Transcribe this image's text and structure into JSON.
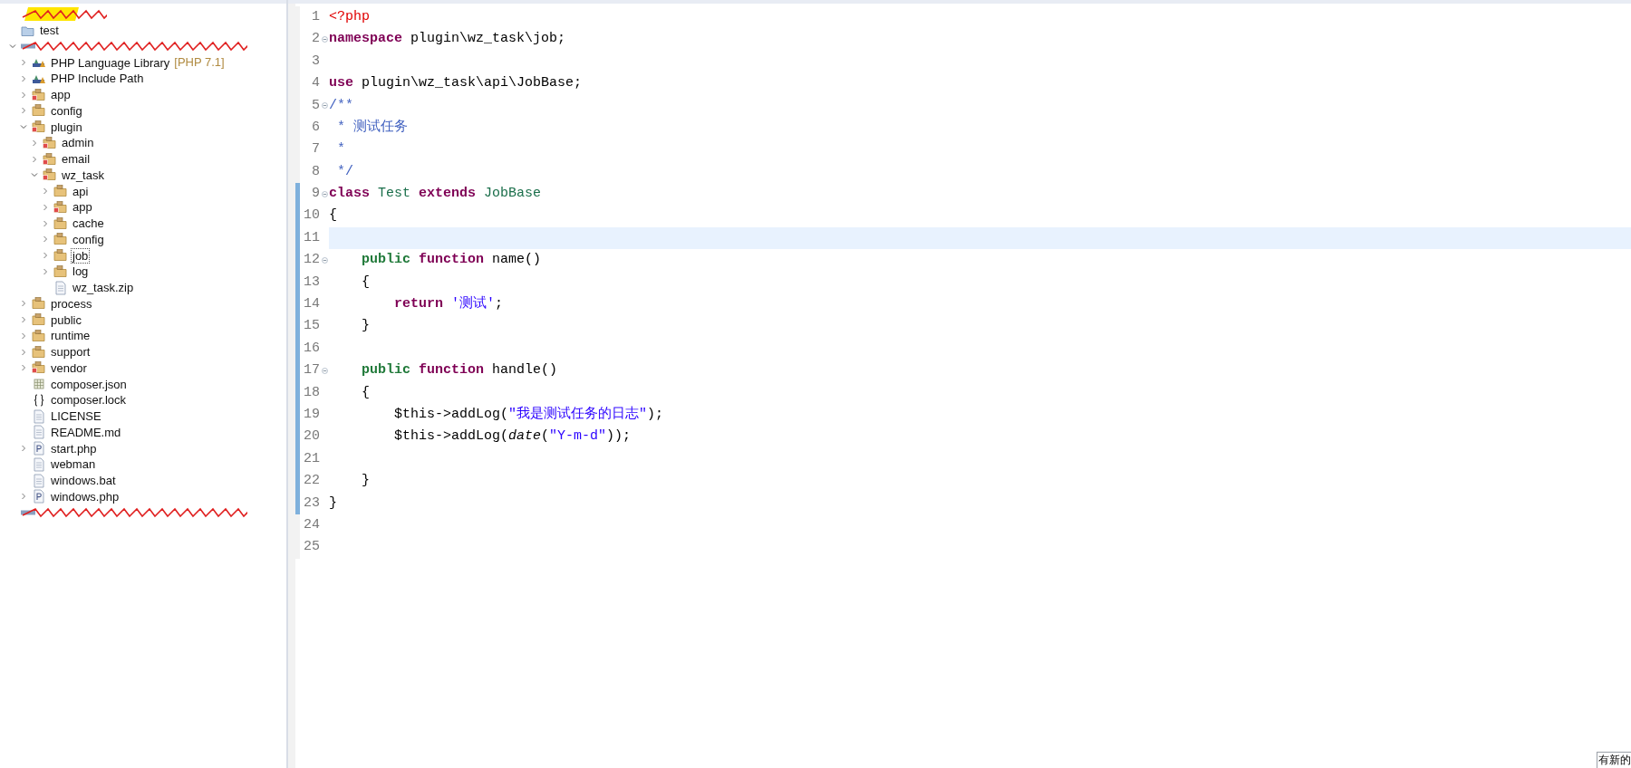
{
  "project_tree": [
    {
      "kind": "redacted",
      "highlight": true
    },
    {
      "kind": "project",
      "label": "test"
    },
    {
      "kind": "redacted",
      "highlight": false,
      "expanded": true,
      "children": [
        {
          "kind": "library",
          "label": "PHP Language Library",
          "suffix": "[PHP 7.1]",
          "expanded": false
        },
        {
          "kind": "library",
          "label": "PHP Include Path",
          "expanded": false
        },
        {
          "kind": "source-folder",
          "label": "app",
          "expanded": false
        },
        {
          "kind": "folder",
          "label": "config",
          "expanded": false
        },
        {
          "kind": "source-folder",
          "label": "plugin",
          "expanded": true,
          "children": [
            {
              "kind": "source-folder",
              "label": "admin",
              "expanded": false
            },
            {
              "kind": "source-folder",
              "label": "email",
              "expanded": false
            },
            {
              "kind": "source-folder",
              "label": "wz_task",
              "expanded": true,
              "children": [
                {
                  "kind": "folder",
                  "label": "api",
                  "expanded": false,
                  "selected": false
                },
                {
                  "kind": "source-folder",
                  "label": "app",
                  "expanded": false,
                  "selected": false
                },
                {
                  "kind": "folder",
                  "label": "cache",
                  "expanded": false,
                  "selected": false
                },
                {
                  "kind": "folder",
                  "label": "config",
                  "expanded": false,
                  "selected": false
                },
                {
                  "kind": "folder",
                  "label": "job",
                  "expanded": false,
                  "selected": true
                },
                {
                  "kind": "folder",
                  "label": "log",
                  "expanded": false,
                  "selected": false
                },
                {
                  "kind": "file",
                  "label": "wz_task.zip"
                }
              ]
            }
          ]
        },
        {
          "kind": "folder",
          "label": "process",
          "expanded": false
        },
        {
          "kind": "folder",
          "label": "public",
          "expanded": false
        },
        {
          "kind": "folder",
          "label": "runtime",
          "expanded": false
        },
        {
          "kind": "folder",
          "label": "support",
          "expanded": false
        },
        {
          "kind": "source-folder",
          "label": "vendor",
          "expanded": false
        },
        {
          "kind": "json",
          "label": "composer.json"
        },
        {
          "kind": "braces",
          "label": "composer.lock"
        },
        {
          "kind": "file",
          "label": "LICENSE"
        },
        {
          "kind": "file",
          "label": "README.md"
        },
        {
          "kind": "php",
          "label": "start.php",
          "expanded": false
        },
        {
          "kind": "file",
          "label": "webman"
        },
        {
          "kind": "file",
          "label": "windows.bat"
        },
        {
          "kind": "php",
          "label": "windows.php",
          "expanded": false
        }
      ]
    },
    {
      "kind": "redacted",
      "highlight": false
    }
  ],
  "editor": {
    "lines": [
      {
        "number": "1",
        "fold": false,
        "changed": false,
        "current": false,
        "tokens": [
          {
            "kind": "tag",
            "text": "<?php"
          }
        ]
      },
      {
        "number": "2",
        "fold": true,
        "changed": false,
        "current": false,
        "tokens": [
          {
            "kind": "keyword",
            "text": "namespace"
          },
          {
            "kind": "plain",
            "text": " plugin\\wz_task\\job;"
          }
        ]
      },
      {
        "number": "3",
        "fold": false,
        "changed": false,
        "current": false
      },
      {
        "number": "4",
        "fold": false,
        "changed": false,
        "current": false,
        "tokens": [
          {
            "kind": "keyword",
            "text": "use"
          },
          {
            "kind": "plain",
            "text": " plugin\\wz_task\\api\\JobBase;"
          }
        ]
      },
      {
        "number": "5",
        "fold": true,
        "changed": false,
        "current": false,
        "tokens": [
          {
            "kind": "comment",
            "text": "/**"
          }
        ]
      },
      {
        "number": "6",
        "fold": false,
        "changed": false,
        "current": false,
        "tokens": [
          {
            "kind": "comment",
            "text": " * 测试任务"
          }
        ]
      },
      {
        "number": "7",
        "fold": false,
        "changed": false,
        "current": false,
        "tokens": [
          {
            "kind": "comment",
            "text": " *"
          }
        ]
      },
      {
        "number": "8",
        "fold": false,
        "changed": false,
        "current": false,
        "tokens": [
          {
            "kind": "comment",
            "text": " */"
          }
        ]
      },
      {
        "number": "9",
        "fold": true,
        "changed": true,
        "current": false,
        "tokens": [
          {
            "kind": "keyword",
            "text": "class"
          },
          {
            "kind": "type",
            "text": " Test"
          },
          {
            "kind": "keyword",
            "text": " extends"
          },
          {
            "kind": "type",
            "text": " JobBase"
          }
        ]
      },
      {
        "number": "10",
        "fold": false,
        "changed": true,
        "current": false,
        "tokens": [
          {
            "kind": "plain",
            "text": "{"
          }
        ]
      },
      {
        "number": "11",
        "fold": false,
        "changed": true,
        "current": true
      },
      {
        "number": "12",
        "fold": true,
        "changed": true,
        "current": false,
        "tokens": [
          {
            "kind": "modifier",
            "text": "    public"
          },
          {
            "kind": "keyword",
            "text": " function"
          },
          {
            "kind": "plain",
            "text": " name()"
          }
        ]
      },
      {
        "number": "13",
        "fold": false,
        "changed": true,
        "current": false,
        "tokens": [
          {
            "kind": "plain",
            "text": "    {"
          }
        ]
      },
      {
        "number": "14",
        "fold": false,
        "changed": true,
        "current": false,
        "tokens": [
          {
            "kind": "keyword",
            "text": "        return"
          },
          {
            "kind": "string",
            "text": " '测试'"
          },
          {
            "kind": "plain",
            "text": ";"
          }
        ]
      },
      {
        "number": "15",
        "fold": false,
        "changed": true,
        "current": false,
        "tokens": [
          {
            "kind": "plain",
            "text": "    }"
          }
        ]
      },
      {
        "number": "16",
        "fold": false,
        "changed": true,
        "current": false
      },
      {
        "number": "17",
        "fold": true,
        "changed": true,
        "current": false,
        "tokens": [
          {
            "kind": "modifier",
            "text": "    public"
          },
          {
            "kind": "keyword",
            "text": " function"
          },
          {
            "kind": "plain",
            "text": " handle()"
          }
        ]
      },
      {
        "number": "18",
        "fold": false,
        "changed": true,
        "current": false,
        "tokens": [
          {
            "kind": "plain",
            "text": "    {"
          }
        ]
      },
      {
        "number": "19",
        "fold": false,
        "changed": true,
        "current": false,
        "tokens": [
          {
            "kind": "plain",
            "text": "        $this->addLog("
          },
          {
            "kind": "string",
            "text": "\"我是测试任务的日志\""
          },
          {
            "kind": "plain",
            "text": ");"
          }
        ]
      },
      {
        "number": "20",
        "fold": false,
        "changed": true,
        "current": false,
        "tokens": [
          {
            "kind": "plain",
            "text": "        $this->addLog("
          },
          {
            "kind": "call",
            "text": "date"
          },
          {
            "kind": "plain",
            "text": "("
          },
          {
            "kind": "string",
            "text": "\"Y-m-d\""
          },
          {
            "kind": "plain",
            "text": "));"
          }
        ]
      },
      {
        "number": "21",
        "fold": false,
        "changed": true,
        "current": false
      },
      {
        "number": "22",
        "fold": false,
        "changed": true,
        "current": false,
        "tokens": [
          {
            "kind": "plain",
            "text": "    }"
          }
        ]
      },
      {
        "number": "23",
        "fold": false,
        "changed": true,
        "current": false,
        "tokens": [
          {
            "kind": "plain",
            "text": "}"
          }
        ]
      },
      {
        "number": "24",
        "fold": false,
        "changed": false,
        "current": false
      },
      {
        "number": "25",
        "fold": false,
        "changed": false,
        "current": false
      }
    ]
  },
  "notification": {
    "text": "有新的"
  }
}
